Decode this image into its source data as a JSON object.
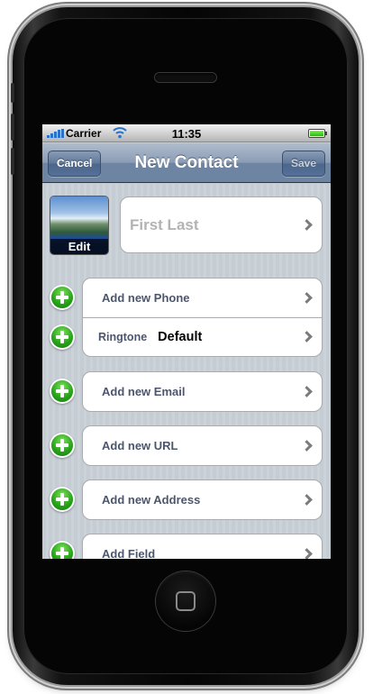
{
  "status_bar": {
    "carrier": "Carrier",
    "time": "11:35",
    "signal_icon": "signal-bars-icon",
    "wifi_icon": "wifi-icon",
    "battery_icon": "battery-icon",
    "battery_level": 1.0
  },
  "nav": {
    "title": "New Contact",
    "cancel_label": "Cancel",
    "save_label": "Save"
  },
  "photo": {
    "edit_label": "Edit"
  },
  "name": {
    "placeholder": "First Last"
  },
  "phone_group": {
    "add_phone_label": "Add new Phone",
    "ringtone_label": "Ringtone",
    "ringtone_value": "Default"
  },
  "fields": {
    "email_label": "Add new Email",
    "url_label": "Add new URL",
    "address_label": "Add new Address",
    "field_label": "Add Field"
  },
  "colors": {
    "nav_bar": "#6d84a2",
    "add_button_green": "#2aa51b",
    "row_label": "#4c566c"
  }
}
